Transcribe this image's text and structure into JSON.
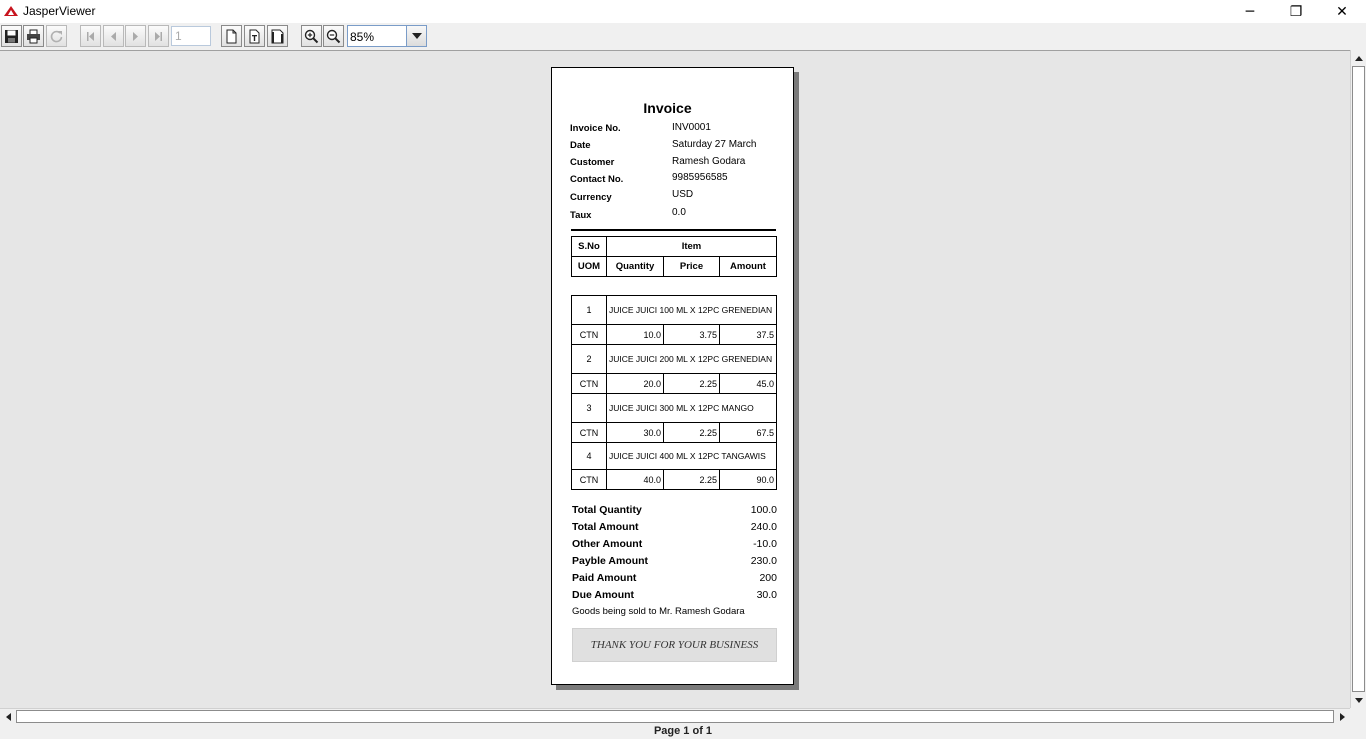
{
  "window": {
    "title": "JasperViewer",
    "minimize_glyph": "─",
    "maximize_glyph": "❐",
    "close_glyph": "✕"
  },
  "toolbar": {
    "page_number": "1",
    "zoom_value": "85%",
    "icons": [
      "save-icon",
      "print-icon",
      "reload-icon",
      "first-page-icon",
      "previous-page-icon",
      "next-page-icon",
      "last-page-icon",
      "actual-size-icon",
      "fit-page-icon",
      "fit-width-icon",
      "zoom-in-icon",
      "zoom-out-icon",
      "chevron-down-icon"
    ]
  },
  "invoice": {
    "title": "Invoice",
    "header": [
      {
        "label": "Invoice No.",
        "value": "INV0001"
      },
      {
        "label": "Date",
        "value": "Saturday 27 March"
      },
      {
        "label": "Customer",
        "value": "Ramesh Godara"
      },
      {
        "label": "Contact No.",
        "value": "9985956585"
      },
      {
        "label": "Currency",
        "value": "USD"
      },
      {
        "label": "Taux",
        "value": "0.0"
      }
    ],
    "columns": {
      "sno": "S.No",
      "item": "Item",
      "uom": "UOM",
      "quantity": "Quantity",
      "price": "Price",
      "amount": "Amount"
    },
    "items": [
      {
        "sno": "1",
        "item": "JUICE JUICI 100 ML X 12PC GRENEDIAN",
        "uom": "CTN",
        "quantity": "10.0",
        "price": "3.75",
        "amount": "37.5"
      },
      {
        "sno": "2",
        "item": "JUICE JUICI 200 ML X 12PC GRENEDIAN",
        "uom": "CTN",
        "quantity": "20.0",
        "price": "2.25",
        "amount": "45.0"
      },
      {
        "sno": "3",
        "item": "JUICE JUICI 300 ML X 12PC MANGO",
        "uom": "CTN",
        "quantity": "30.0",
        "price": "2.25",
        "amount": "67.5"
      },
      {
        "sno": "4",
        "item": "JUICE JUICI 400 ML X 12PC TANGAWIS",
        "uom": "CTN",
        "quantity": "40.0",
        "price": "2.25",
        "amount": "90.0"
      }
    ],
    "totals": [
      {
        "label": "Total Quantity",
        "value": "100.0"
      },
      {
        "label": "Total Amount",
        "value": "240.0"
      },
      {
        "label": "Other Amount",
        "value": "-10.0"
      },
      {
        "label": "Payble Amount",
        "value": "230.0"
      },
      {
        "label": "Paid Amount",
        "value": "200"
      },
      {
        "label": "Due Amount",
        "value": "30.0"
      }
    ],
    "note": "Goods being sold to Mr. Ramesh Godara",
    "thanks": "THANK YOU FOR YOUR BUSINESS"
  },
  "status": {
    "page_info": "Page 1 of 1"
  }
}
